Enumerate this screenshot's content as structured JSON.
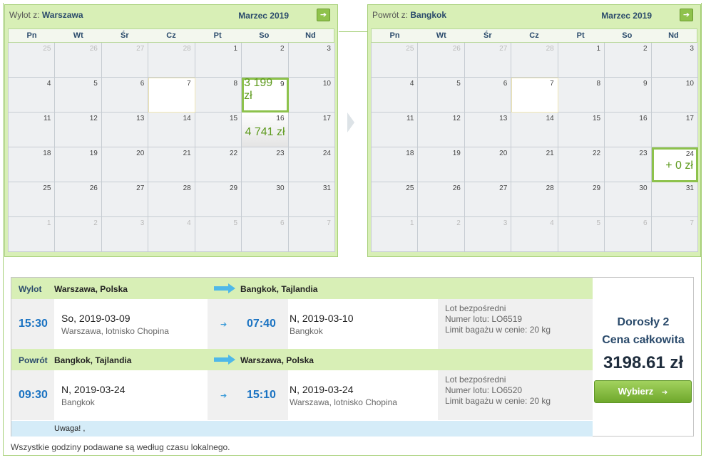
{
  "outbound_calendar": {
    "label": "Wylot z:",
    "city": "Warszawa",
    "month": "Marzec 2019",
    "next_icon": "arrow-right-icon",
    "weekdays": [
      "Pn",
      "Wt",
      "Śr",
      "Cz",
      "Pt",
      "So",
      "Nd"
    ],
    "weeks": [
      [
        {
          "d": "25",
          "o": true
        },
        {
          "d": "26",
          "o": true
        },
        {
          "d": "27",
          "o": true
        },
        {
          "d": "28",
          "o": true
        },
        {
          "d": "1"
        },
        {
          "d": "2"
        },
        {
          "d": "3"
        }
      ],
      [
        {
          "d": "4"
        },
        {
          "d": "5"
        },
        {
          "d": "6"
        },
        {
          "d": "7",
          "today": true
        },
        {
          "d": "8"
        },
        {
          "d": "9",
          "price": "3 199 zł",
          "selected": true
        },
        {
          "d": "10"
        }
      ],
      [
        {
          "d": "11"
        },
        {
          "d": "12"
        },
        {
          "d": "13"
        },
        {
          "d": "14"
        },
        {
          "d": "15"
        },
        {
          "d": "16",
          "price": "4 741 zł"
        },
        {
          "d": "17"
        }
      ],
      [
        {
          "d": "18"
        },
        {
          "d": "19"
        },
        {
          "d": "20"
        },
        {
          "d": "21"
        },
        {
          "d": "22"
        },
        {
          "d": "23"
        },
        {
          "d": "24"
        }
      ],
      [
        {
          "d": "25"
        },
        {
          "d": "26"
        },
        {
          "d": "27"
        },
        {
          "d": "28"
        },
        {
          "d": "29"
        },
        {
          "d": "30"
        },
        {
          "d": "31"
        }
      ],
      [
        {
          "d": "1",
          "o": true
        },
        {
          "d": "2",
          "o": true
        },
        {
          "d": "3",
          "o": true
        },
        {
          "d": "4",
          "o": true
        },
        {
          "d": "5",
          "o": true
        },
        {
          "d": "6",
          "o": true
        },
        {
          "d": "7",
          "o": true
        }
      ]
    ]
  },
  "return_calendar": {
    "label": "Powrót z:",
    "city": "Bangkok",
    "month": "Marzec 2019",
    "next_icon": "arrow-right-icon",
    "weekdays": [
      "Pn",
      "Wt",
      "Śr",
      "Cz",
      "Pt",
      "So",
      "Nd"
    ],
    "weeks": [
      [
        {
          "d": "25",
          "o": true
        },
        {
          "d": "26",
          "o": true
        },
        {
          "d": "27",
          "o": true
        },
        {
          "d": "28",
          "o": true
        },
        {
          "d": "1"
        },
        {
          "d": "2"
        },
        {
          "d": "3"
        }
      ],
      [
        {
          "d": "4"
        },
        {
          "d": "5"
        },
        {
          "d": "6"
        },
        {
          "d": "7",
          "today": true
        },
        {
          "d": "8"
        },
        {
          "d": "9"
        },
        {
          "d": "10"
        }
      ],
      [
        {
          "d": "11"
        },
        {
          "d": "12"
        },
        {
          "d": "13"
        },
        {
          "d": "14"
        },
        {
          "d": "15"
        },
        {
          "d": "16"
        },
        {
          "d": "17"
        }
      ],
      [
        {
          "d": "18"
        },
        {
          "d": "19"
        },
        {
          "d": "20"
        },
        {
          "d": "21"
        },
        {
          "d": "22"
        },
        {
          "d": "23"
        },
        {
          "d": "24",
          "price": "+ 0 zł",
          "selected": true
        }
      ],
      [
        {
          "d": "25"
        },
        {
          "d": "26"
        },
        {
          "d": "27"
        },
        {
          "d": "28"
        },
        {
          "d": "29"
        },
        {
          "d": "30"
        },
        {
          "d": "31"
        }
      ],
      [
        {
          "d": "1",
          "o": true
        },
        {
          "d": "2",
          "o": true
        },
        {
          "d": "3",
          "o": true
        },
        {
          "d": "4",
          "o": true
        },
        {
          "d": "5",
          "o": true
        },
        {
          "d": "6",
          "o": true
        },
        {
          "d": "7",
          "o": true
        }
      ]
    ]
  },
  "outbound": {
    "label": "Wylot",
    "from": "Warszawa, Polska",
    "to": "Bangkok, Tajlandia",
    "dep_time": "15:30",
    "dep_day": "So,",
    "dep_date": "2019-03-09",
    "dep_place": "Warszawa, lotnisko Chopina",
    "arr_time": "07:40",
    "arr_day": "N,",
    "arr_date": "2019-03-10",
    "arr_place": "Bangkok",
    "direct": "Lot bezpośredni",
    "flight_no": "Numer lotu: LO6519",
    "baggage": "Limit bagażu w cenie: 20 kg"
  },
  "return": {
    "label": "Powrót",
    "from": "Bangkok, Tajlandia",
    "to": "Warszawa, Polska",
    "dep_time": "09:30",
    "dep_day": "N,",
    "dep_date": "2019-03-24",
    "dep_place": "Bangkok",
    "arr_time": "15:10",
    "arr_day": "N,",
    "arr_date": "2019-03-24",
    "arr_place": "Warszawa, lotnisko Chopina",
    "direct": "Lot bezpośredni",
    "flight_no": "Numer lotu: LO6520",
    "baggage": "Limit bagażu w cenie: 20 kg"
  },
  "note": "Uwaga! ,",
  "summary": {
    "passengers": "Dorosły 2",
    "total_label": "Cena całkowita",
    "total": "3198.61 zł",
    "select_label": "Wybierz",
    "select_icon": "arrow-right-icon"
  },
  "footer": "Wszystkie godziny podawane są według czasu lokalnego.",
  "colors": {
    "calendar_bg": "#d8efb6",
    "accent_green": "#8dc24c",
    "price_green": "#5e9a1e",
    "time_blue": "#1b73c2",
    "note_bg": "#d5ecf8"
  }
}
